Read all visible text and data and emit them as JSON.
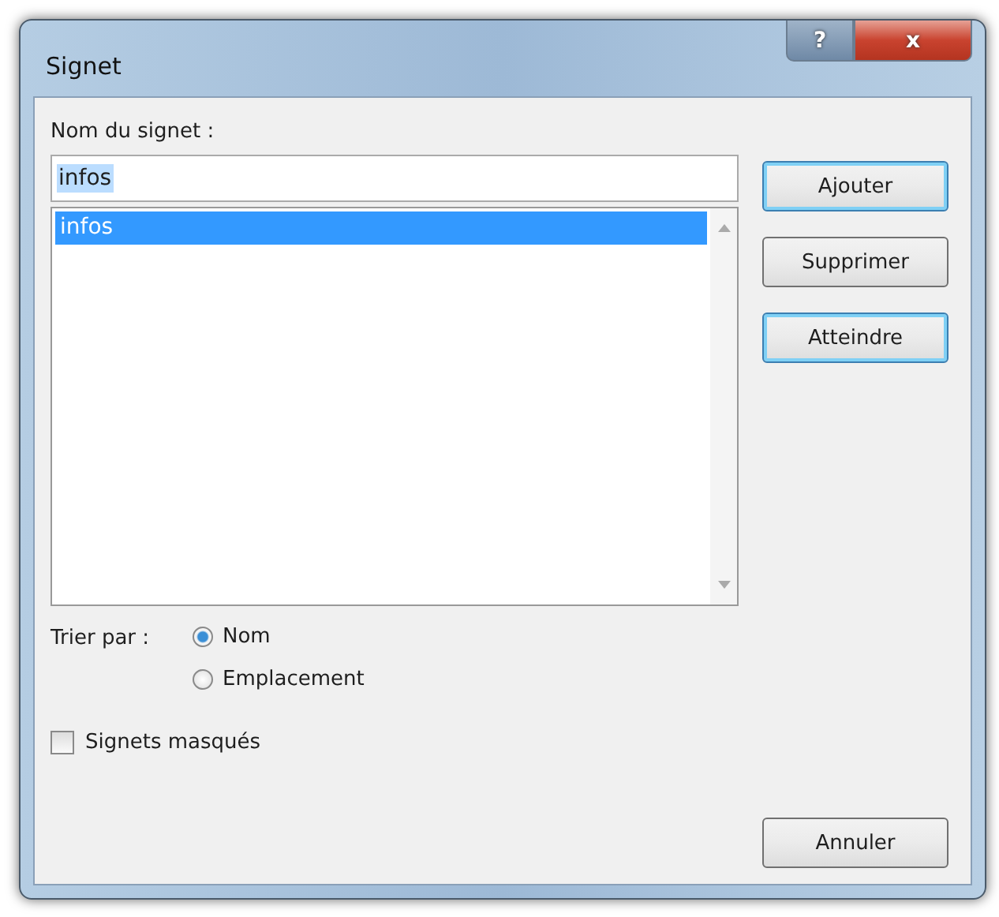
{
  "window": {
    "title": "Signet",
    "help": "?",
    "close": "x"
  },
  "name_label": "Nom du signet :",
  "name_field": {
    "value": "infos",
    "text_selected": true
  },
  "bookmarks": [
    {
      "label": "infos",
      "selected": true
    }
  ],
  "buttons": [
    {
      "label": "Ajouter",
      "highlighted": true
    },
    {
      "label": "Supprimer",
      "highlighted": false
    },
    {
      "label": "Atteindre",
      "highlighted": true
    }
  ],
  "sort_label": "Trier par :",
  "sort_options": [
    {
      "label": "Nom",
      "selected": true
    },
    {
      "label": "Emplacement",
      "selected": false
    }
  ],
  "hidden_bookmarks": {
    "label": "Signets masqués",
    "checked": false
  },
  "cancel": "Annuler"
}
